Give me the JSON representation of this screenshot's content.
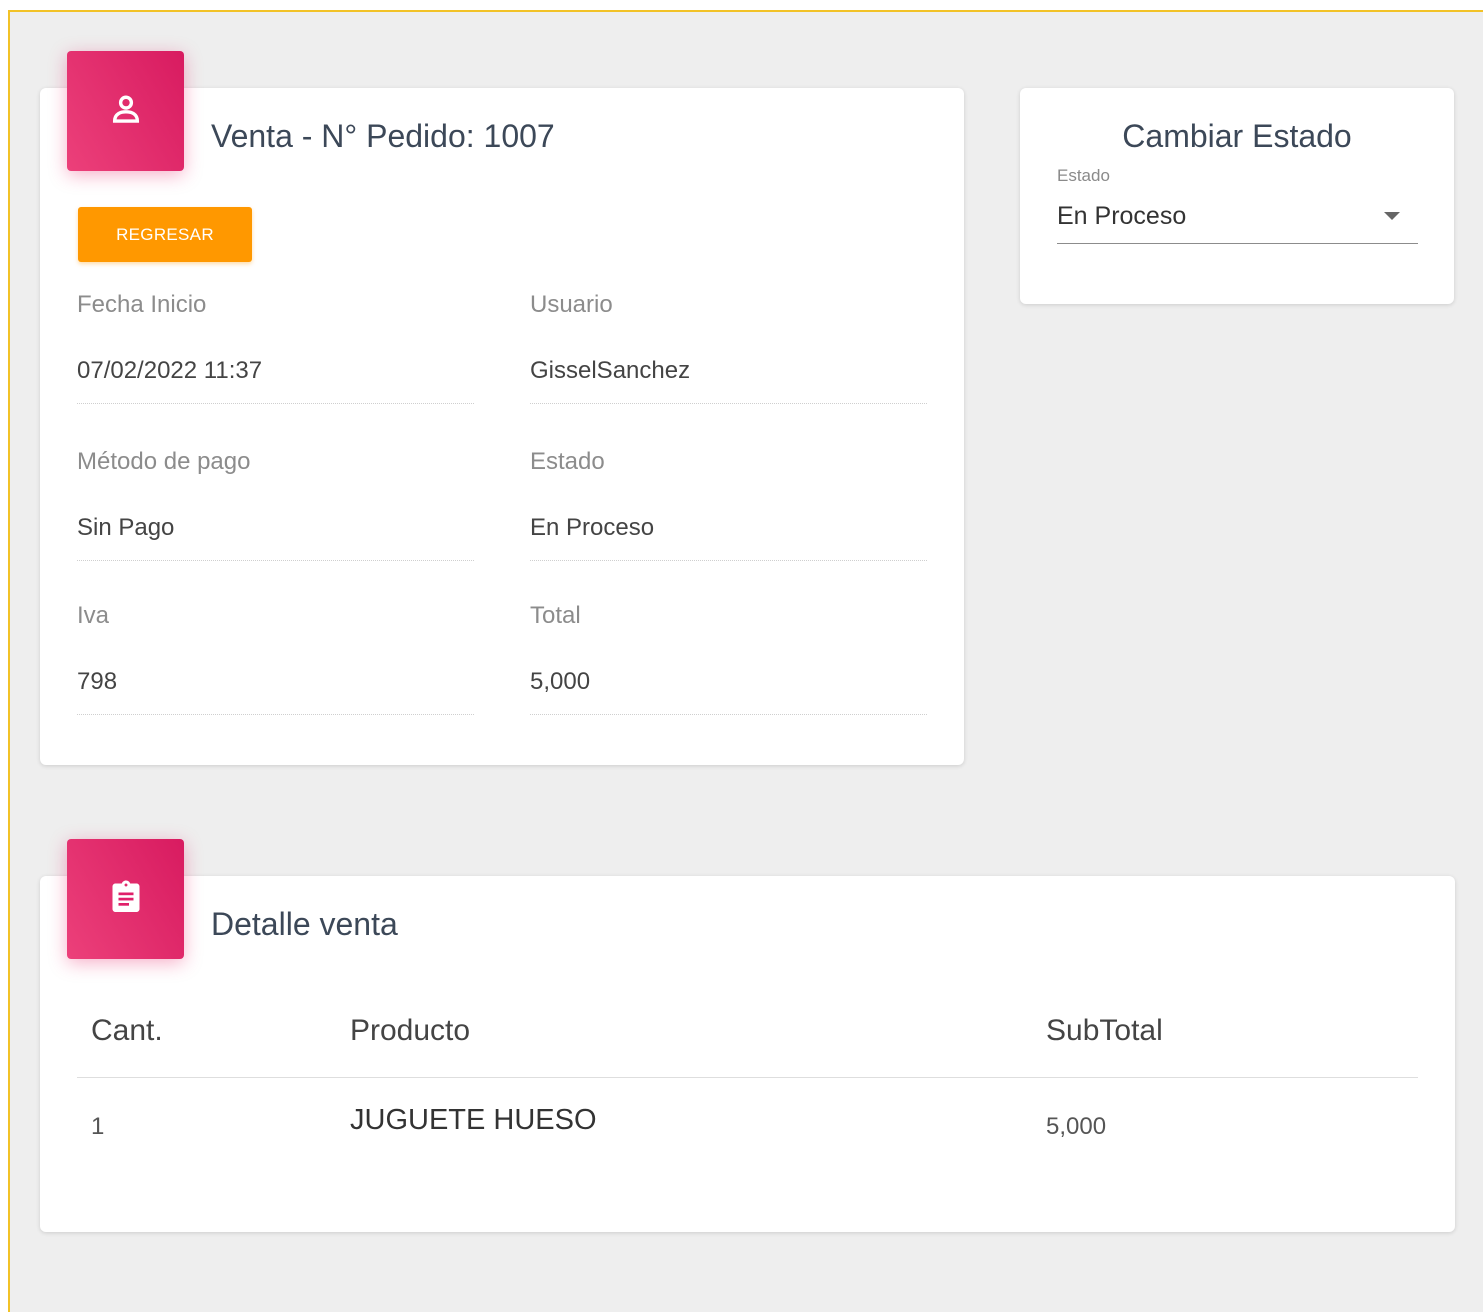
{
  "venta_card": {
    "title": "Venta - N° Pedido: 1007",
    "icon": "person-icon",
    "back_button": "REGRESAR",
    "fields": {
      "fecha_inicio": {
        "label": "Fecha Inicio",
        "value": "07/02/2022 11:37"
      },
      "usuario": {
        "label": "Usuario",
        "value": "GisselSanchez"
      },
      "metodo_pago": {
        "label": "Método de pago",
        "value": "Sin Pago"
      },
      "estado": {
        "label": "Estado",
        "value": "En Proceso"
      },
      "iva": {
        "label": "Iva",
        "value": "798"
      },
      "total": {
        "label": "Total",
        "value": "5,000"
      }
    }
  },
  "estado_card": {
    "title": "Cambiar Estado",
    "select_label": "Estado",
    "select_value": "En Proceso"
  },
  "detalle_card": {
    "title": "Detalle venta",
    "icon": "clipboard-icon",
    "columns": [
      "Cant.",
      "Producto",
      "SubTotal"
    ],
    "rows": [
      {
        "cant": "1",
        "producto": "JUGUETE HUESO",
        "subtotal": "5,000"
      }
    ]
  },
  "colors": {
    "accent_pink": "#e91e63",
    "button_orange": "#ff9800",
    "frame_border": "#f2c227",
    "background": "#eeeeee"
  }
}
